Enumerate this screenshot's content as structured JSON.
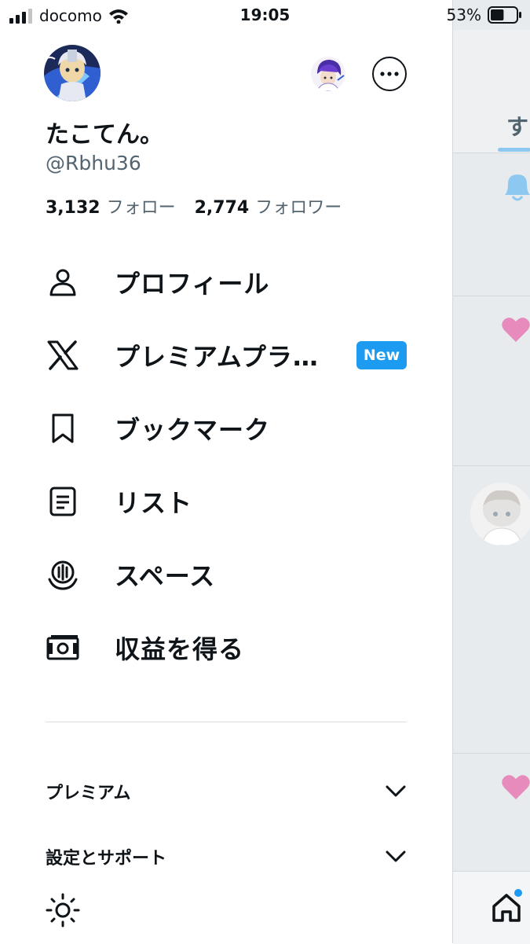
{
  "status_bar": {
    "carrier": "docomo",
    "time": "19:05",
    "battery": "53%",
    "battery_level": 0.53
  },
  "timeline": {
    "tab_partial": "す"
  },
  "profile": {
    "display_name": "たこてん。",
    "handle": "@Rbhu36",
    "following_count": "3,132",
    "following_label": "フォロー",
    "followers_count": "2,774",
    "followers_label": "フォロワー"
  },
  "menu": {
    "items": [
      {
        "label": "プロフィール",
        "icon": "person-icon"
      },
      {
        "label": "プレミアムプラ…",
        "icon": "x-logo-icon",
        "badge": "New"
      },
      {
        "label": "ブックマーク",
        "icon": "bookmark-icon"
      },
      {
        "label": "リスト",
        "icon": "list-icon"
      },
      {
        "label": "スペース",
        "icon": "spaces-icon"
      },
      {
        "label": "収益を得る",
        "icon": "money-icon"
      }
    ]
  },
  "sections": {
    "premium": "プレミアム",
    "settings_support": "設定とサポート"
  },
  "colors": {
    "accent": "#1d9bf0",
    "text_primary": "#0f1419",
    "text_secondary": "#536471",
    "like_pink": "#e78bbd",
    "bell_blue": "#8cc8f0"
  }
}
